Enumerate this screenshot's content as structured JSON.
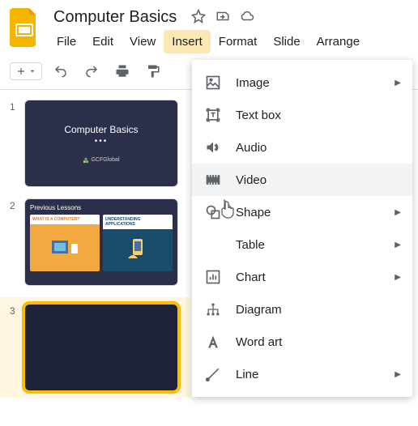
{
  "document": {
    "title": "Computer Basics"
  },
  "menubar": {
    "file": "File",
    "edit": "Edit",
    "view": "View",
    "insert": "Insert",
    "format": "Format",
    "slide": "Slide",
    "arrange": "Arrange"
  },
  "thumbnails": [
    {
      "num": "1",
      "title": "Computer Basics",
      "logo": "GCFGlobal"
    },
    {
      "num": "2",
      "title": "Previous Lessons",
      "card1": "WHAT IS A COMPUTER?",
      "card2": "UNDERSTANDING APPLICATIONS"
    },
    {
      "num": "3"
    }
  ],
  "insert_menu": {
    "image": "Image",
    "textbox": "Text box",
    "audio": "Audio",
    "video": "Video",
    "shape": "Shape",
    "table": "Table",
    "chart": "Chart",
    "diagram": "Diagram",
    "wordart": "Word art",
    "line": "Line"
  }
}
